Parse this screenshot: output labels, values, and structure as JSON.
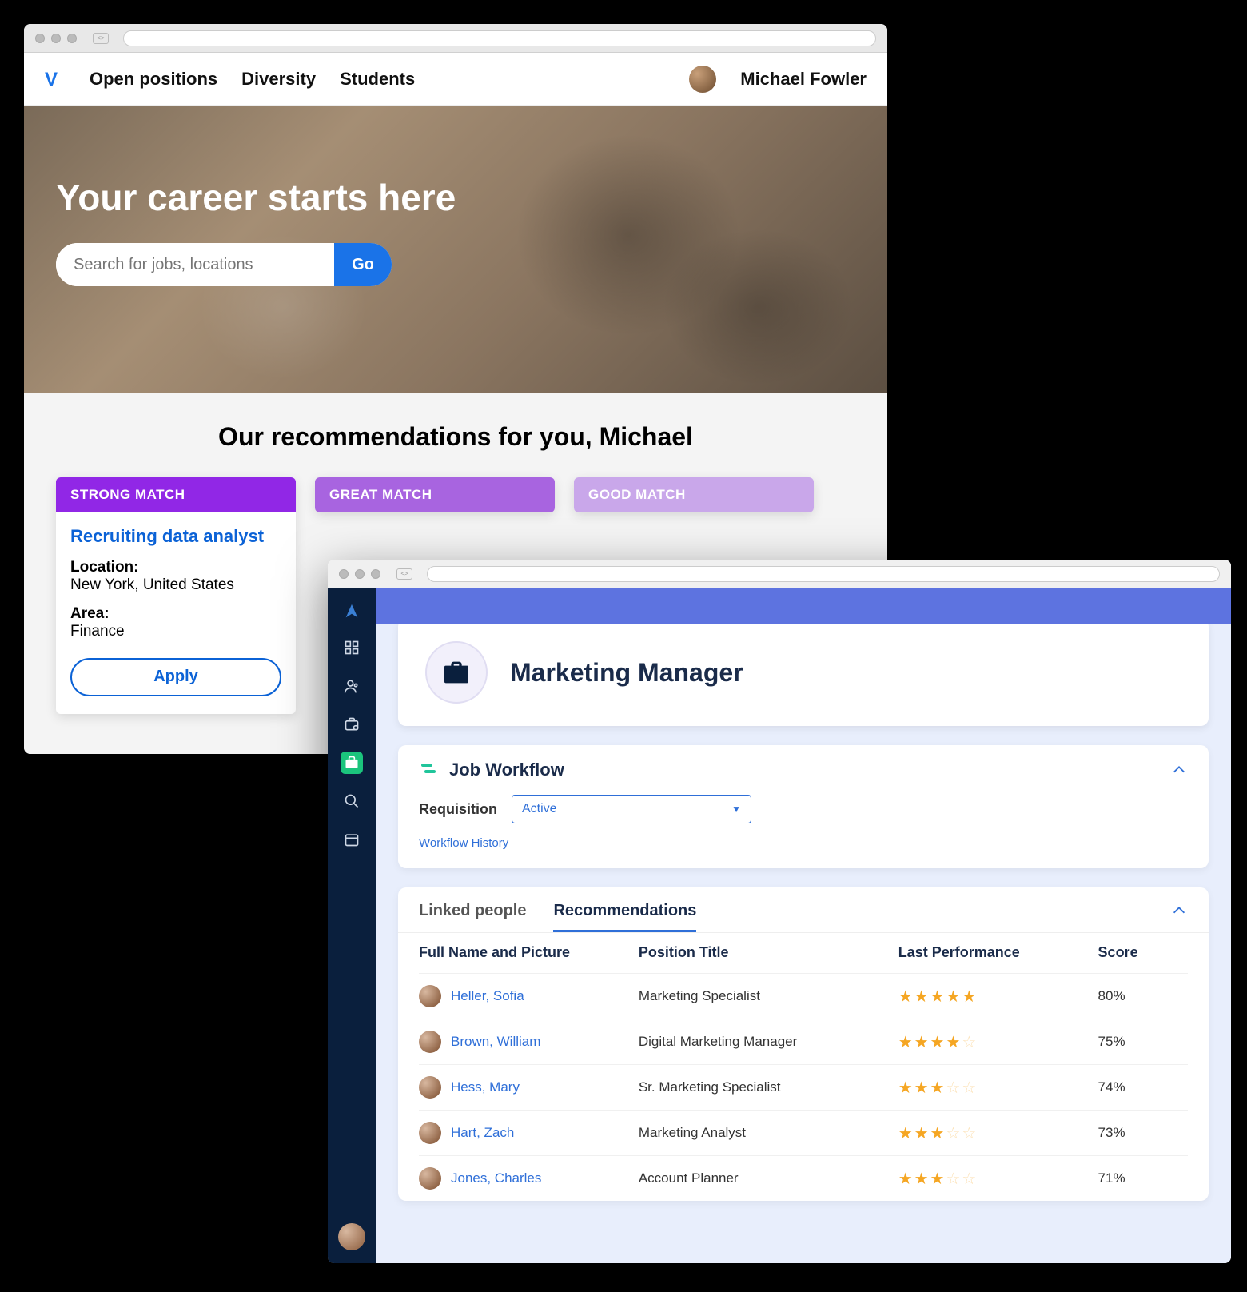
{
  "win1": {
    "nav": {
      "items": [
        "Open positions",
        "Diversity",
        "Students"
      ],
      "user_name": "Michael Fowler"
    },
    "hero": {
      "title": "Your career starts here",
      "search_placeholder": "Search for jobs, locations",
      "go_label": "Go"
    },
    "recs": {
      "heading": "Our recommendations for you, Michael",
      "cards": [
        {
          "badge": "STRONG MATCH",
          "title": "Recruiting data analyst",
          "location_label": "Location:",
          "location_value": "New York, United States",
          "area_label": "Area:",
          "area_value": "Finance",
          "apply_label": "Apply"
        },
        {
          "badge": "GREAT MATCH"
        },
        {
          "badge": "GOOD MATCH"
        }
      ]
    }
  },
  "win2": {
    "title": "Marketing Manager",
    "workflow": {
      "heading": "Job Workflow",
      "req_label": "Requisition",
      "req_value": "Active",
      "history_link": "Workflow History"
    },
    "tabs": {
      "linked": "Linked people",
      "recs": "Recommendations"
    },
    "table": {
      "headers": {
        "name": "Full Name and Picture",
        "position": "Position Title",
        "perf": "Last Performance",
        "score": "Score"
      },
      "rows": [
        {
          "name": "Heller, Sofia",
          "position": "Marketing Specialist",
          "stars": 5,
          "score": "80%"
        },
        {
          "name": "Brown, William",
          "position": "Digital Marketing Manager",
          "stars": 4,
          "score": "75%"
        },
        {
          "name": "Hess, Mary",
          "position": "Sr. Marketing Specialist",
          "stars": 3,
          "score": "74%"
        },
        {
          "name": "Hart, Zach",
          "position": "Marketing Analyst",
          "stars": 3,
          "score": "73%"
        },
        {
          "name": "Jones, Charles",
          "position": "Account Planner",
          "stars": 3,
          "score": "71%"
        }
      ]
    }
  }
}
